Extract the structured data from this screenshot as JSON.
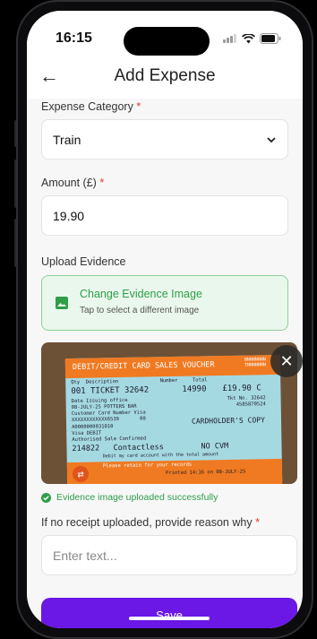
{
  "status": {
    "time": "16:15"
  },
  "nav": {
    "back_glyph": "←",
    "title": "Add Expense"
  },
  "form": {
    "category_label": "Expense Category",
    "category_value": "Train",
    "amount_label": "Amount (£)",
    "amount_value": "19.90",
    "upload_label": "Upload Evidence",
    "upload_title": "Change Evidence Image",
    "upload_subtitle": "Tap to select a different image",
    "upload_success": "Evidence image uploaded successfully",
    "reason_label": "If no receipt uploaded, provide reason why",
    "reason_placeholder": "Enter text...",
    "save_label": "Save",
    "required_mark": "*"
  },
  "ticket": {
    "header": "DEBIT/CREDIT CARD SALES VOUCHER",
    "ref": "NNNNNNNN\nTNNNNNNN",
    "cols": "Qty  Description              Number     Total",
    "line1": "001  TICKET 32642",
    "line1_number": "14990",
    "line1_total": "£19.90  C",
    "date_row": "Date      Issuing office",
    "tkt_no": "Tkt No. 32642",
    "date_val": "08-JULY-25  POTTERS BAR",
    "tkt_no2": "4585870524",
    "card_row": "Customer Card Number    Visa",
    "card_num": "XXXXXXXXXXXX6539       00",
    "copy": "CARDHOLDER'S COPY",
    "aid": "A0000000031010",
    "visa": "Visa DEBIT",
    "auth": "Authorised Sale Confirmed",
    "auth_code": "214822   Contactless",
    "cvm": "NO CVM",
    "debit": "Debit my card account with the total amount",
    "retain": "Please retain for your records",
    "printed": "Printed 14:16 on 08-JULY-25"
  },
  "colors": {
    "accent": "#6b17e6",
    "success": "#2e9e48",
    "required": "#e53935",
    "ticket_orange": "#f07a22",
    "ticket_blue": "#a5d9e2"
  },
  "icons": {
    "back": "arrow-left-icon",
    "dropdown": "chevron-down-icon",
    "upload": "image-icon",
    "close": "close-icon",
    "success": "check-circle-icon"
  }
}
